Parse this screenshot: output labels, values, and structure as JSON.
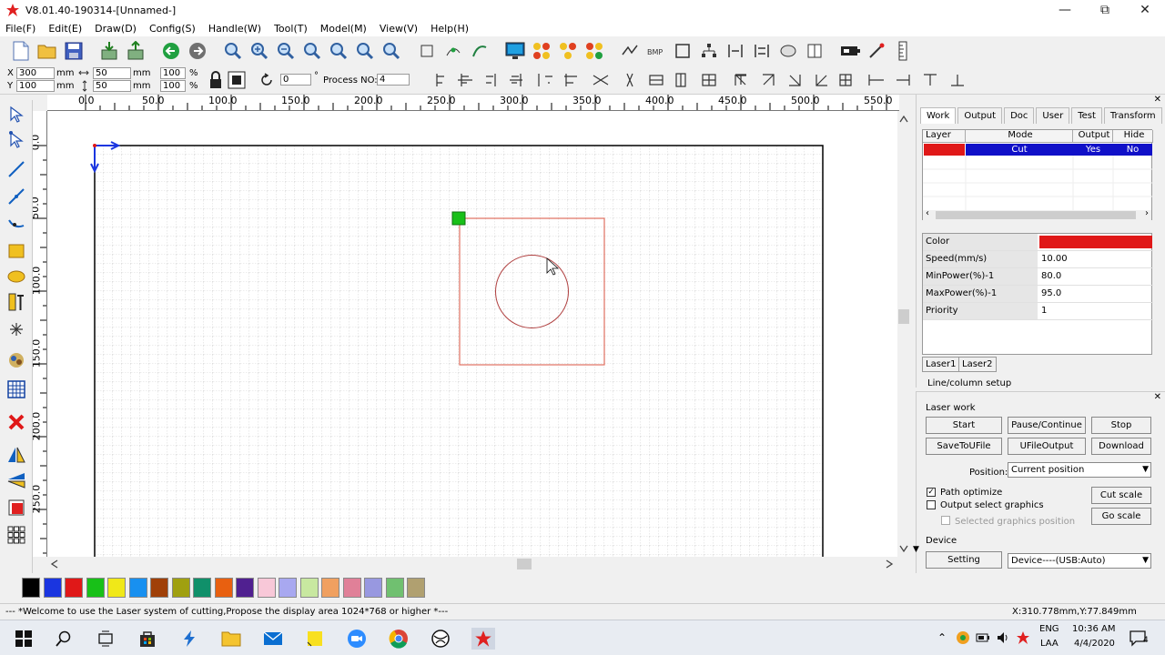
{
  "window": {
    "title": "V8.01.40-190314-[Unnamed-]",
    "min_glyph": "—",
    "max_glyph": "⧉",
    "close_glyph": "✕"
  },
  "menu": [
    "File(F)",
    "Edit(E)",
    "Draw(D)",
    "Config(S)",
    "Handle(W)",
    "Tool(T)",
    "Model(M)",
    "View(V)",
    "Help(H)"
  ],
  "toolbar2": {
    "x_label": "X",
    "x_value": "300",
    "y_label": "Y",
    "y_value": "100",
    "unit_mm": "mm",
    "w_value": "50",
    "h_value": "50",
    "w_pct": "100",
    "h_pct": "100",
    "pct": "%",
    "rotate_value": "0",
    "deg": "°",
    "process_label": "Process NO:",
    "process_value": "4"
  },
  "hruler_labels": [
    "0.0",
    "50.0",
    "100.0",
    "150.0",
    "200.0",
    "250.0",
    "300.0",
    "350.0",
    "400.0",
    "450.0",
    "500.0",
    "550.0"
  ],
  "vruler_labels": [
    "0.0",
    "50.0",
    "100.0",
    "150.0",
    "200.0",
    "250.0"
  ],
  "palette": [
    "#000000",
    "#1a35e0",
    "#e01818",
    "#18c018",
    "#f0e818",
    "#1890f0",
    "#a04008",
    "#a0a010",
    "#10906a",
    "#e86010",
    "#502090",
    "#f8c8d8",
    "#a8a8f0",
    "#c8e8a0",
    "#f0a060",
    "#e08098",
    "#9898e0",
    "#70c070",
    "#b0a070"
  ],
  "status": {
    "message": "--- *Welcome to use the Laser system of cutting,Propose the display area 1024*768 or higher *---",
    "coords": "X:310.778mm,Y:77.849mm"
  },
  "panel": {
    "tabs": [
      "Work",
      "Output",
      "Doc",
      "User",
      "Test",
      "Transform"
    ],
    "layer_headers": [
      "Layer",
      "Mode",
      "Output",
      "Hide"
    ],
    "layer_row": {
      "color": "#e01818",
      "mode": "Cut",
      "output": "Yes",
      "hide": "No"
    },
    "props": [
      {
        "name": "Color",
        "value": ""
      },
      {
        "name": "Speed(mm/s)",
        "value": "10.00"
      },
      {
        "name": "MinPower(%)-1",
        "value": "80.0"
      },
      {
        "name": "MaxPower(%)-1",
        "value": "95.0"
      },
      {
        "name": "Priority",
        "value": "1"
      }
    ],
    "prop_color": "#e01818",
    "laser_tabs": [
      "Laser1",
      "Laser2"
    ],
    "cut_text": "Line/column setup"
  },
  "laserwork": {
    "title": "Laser work",
    "start": "Start",
    "pause": "Pause/Continue",
    "stop": "Stop",
    "save": "SaveToUFile",
    "ufile": "UFileOutput",
    "download": "Download",
    "position_label": "Position:",
    "position_value": "Current position",
    "path_optimize": "Path optimize",
    "output_select": "Output select graphics",
    "selected_pos": "Selected graphics position",
    "cut_scale": "Cut scale",
    "go_scale": "Go scale",
    "device_title": "Device",
    "setting": "Setting",
    "device_value": "Device----(USB:Auto)"
  },
  "taskbar": {
    "lang": "ENG",
    "layout": "LAA",
    "time": "10:36 AM",
    "date": "4/4/2020",
    "notif_count": "4"
  }
}
